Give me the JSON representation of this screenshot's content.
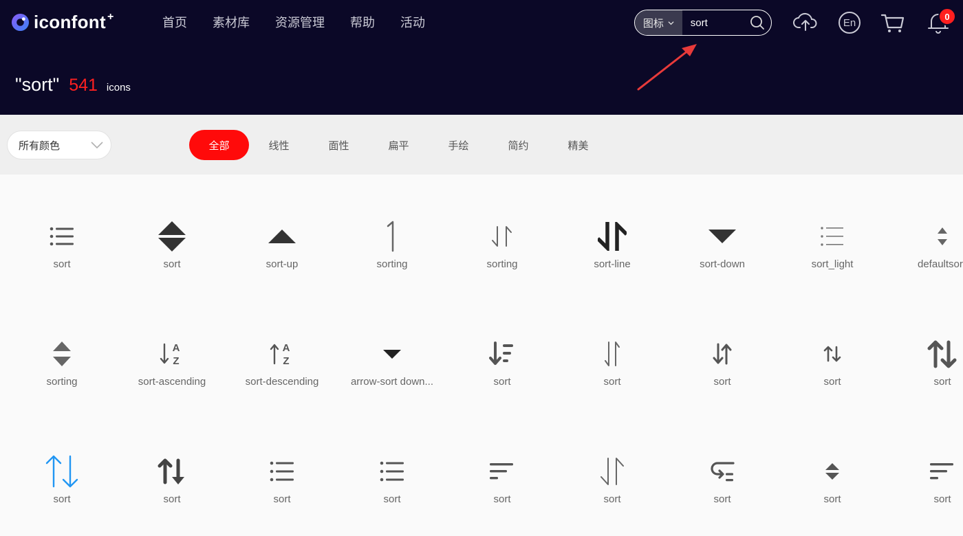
{
  "brand": {
    "name": "iconfont",
    "plus": "+"
  },
  "nav": [
    "首页",
    "素材库",
    "资源管理",
    "帮助",
    "活动"
  ],
  "search": {
    "type_label": "图标",
    "query": "sort"
  },
  "header_icons": [
    "upload-cloud-icon",
    "language-en-icon",
    "cart-icon",
    "bell-icon"
  ],
  "lang_label": "En",
  "notification_count": "0",
  "results": {
    "query_display": "\"sort\"",
    "count": "541",
    "unit": "icons"
  },
  "filters": {
    "color_select": "所有颜色",
    "tabs": [
      "全部",
      "线性",
      "面性",
      "扁平",
      "手绘",
      "简约",
      "精美"
    ],
    "active_tab": "全部"
  },
  "icons": [
    {
      "label": "sort",
      "glyph": "list-bullets"
    },
    {
      "label": "sort",
      "glyph": "triangle-up-down-large"
    },
    {
      "label": "sort-up",
      "glyph": "triangle-up"
    },
    {
      "label": "sorting",
      "glyph": "thin-one"
    },
    {
      "label": "sorting",
      "glyph": "thin-down-up-arrows"
    },
    {
      "label": "sort-line",
      "glyph": "bold-down-up-arrows"
    },
    {
      "label": "sort-down",
      "glyph": "triangle-down"
    },
    {
      "label": "sort_light",
      "glyph": "list-bullets-light"
    },
    {
      "label": "defaultsort",
      "glyph": "small-up-down-triangles"
    },
    {
      "label": "sorting",
      "glyph": "triangle-up-down-gap"
    },
    {
      "label": "sort-ascending",
      "glyph": "arrow-down-az"
    },
    {
      "label": "sort-descending",
      "glyph": "arrow-up-az"
    },
    {
      "label": "arrow-sort down...",
      "glyph": "triangle-down-small"
    },
    {
      "label": "sort",
      "glyph": "arrow-down-bars"
    },
    {
      "label": "sort",
      "glyph": "thin-down-up-arrows-2"
    },
    {
      "label": "sort",
      "glyph": "medium-down-up-arrows"
    },
    {
      "label": "sort",
      "glyph": "small-up-down-arrows"
    },
    {
      "label": "sort",
      "glyph": "bold-up-down-arrows"
    },
    {
      "label": "sort",
      "glyph": "blue-up-down-arrows"
    },
    {
      "label": "sort",
      "glyph": "bold-up-down-arrows-2"
    },
    {
      "label": "sort",
      "glyph": "list-bullets-2"
    },
    {
      "label": "sort",
      "glyph": "list-bullets-3"
    },
    {
      "label": "sort",
      "glyph": "lines-decreasing"
    },
    {
      "label": "sort",
      "glyph": "thin-down-up-long"
    },
    {
      "label": "sort",
      "glyph": "return-list"
    },
    {
      "label": "sort",
      "glyph": "diamond-up-down"
    },
    {
      "label": "sort",
      "glyph": "lines-decreasing-2"
    }
  ],
  "colors": {
    "header_bg": "#0b0827",
    "accent": "#ff0a0a",
    "icon_dark": "#555555",
    "icon_blue": "#2196f3"
  }
}
